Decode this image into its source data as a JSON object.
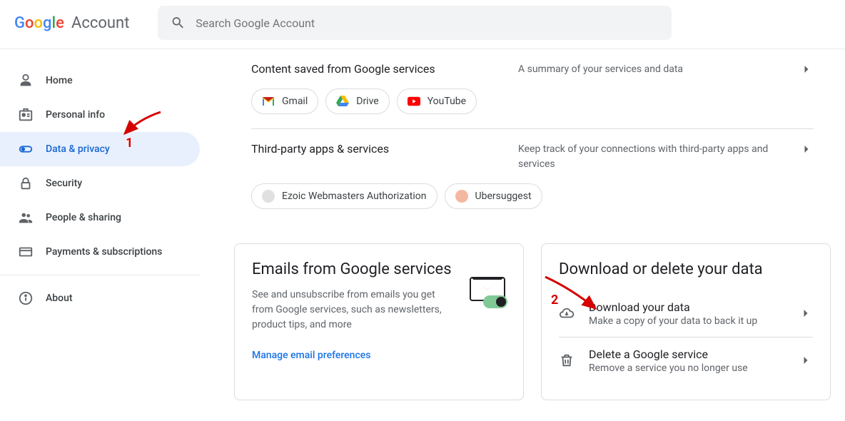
{
  "header": {
    "logo_account": "Account",
    "search": {
      "placeholder": "Search Google Account"
    }
  },
  "sidebar": {
    "items": [
      {
        "label": "Home"
      },
      {
        "label": "Personal info"
      },
      {
        "label": "Data & privacy"
      },
      {
        "label": "Security"
      },
      {
        "label": "People & sharing"
      },
      {
        "label": "Payments & subscriptions"
      }
    ],
    "about": {
      "label": "About"
    }
  },
  "content": {
    "saved": {
      "title": "Content saved from Google services",
      "summary": "A summary of your services and data",
      "chips": [
        {
          "label": "Gmail"
        },
        {
          "label": "Drive"
        },
        {
          "label": "YouTube"
        }
      ]
    },
    "third_party": {
      "title": "Third-party apps & services",
      "summary": "Keep track of your connections with third-party apps and services",
      "chips": [
        {
          "label": "Ezoic Webmasters Authorization"
        },
        {
          "label": "Ubersuggest"
        }
      ]
    },
    "emails_card": {
      "title": "Emails from Google services",
      "body": "See and unsubscribe from emails you get from Google services, such as newslet­ters, product tips, and more",
      "link": "Manage email preferences"
    },
    "data_card": {
      "title": "Download or delete your data",
      "actions": [
        {
          "title": "Download your data",
          "sub": "Make a copy of your data to back it up"
        },
        {
          "title": "Delete a Google service",
          "sub": "Remove a service you no longer use"
        }
      ]
    }
  },
  "annotations": {
    "num1": "1",
    "num2": "2"
  }
}
